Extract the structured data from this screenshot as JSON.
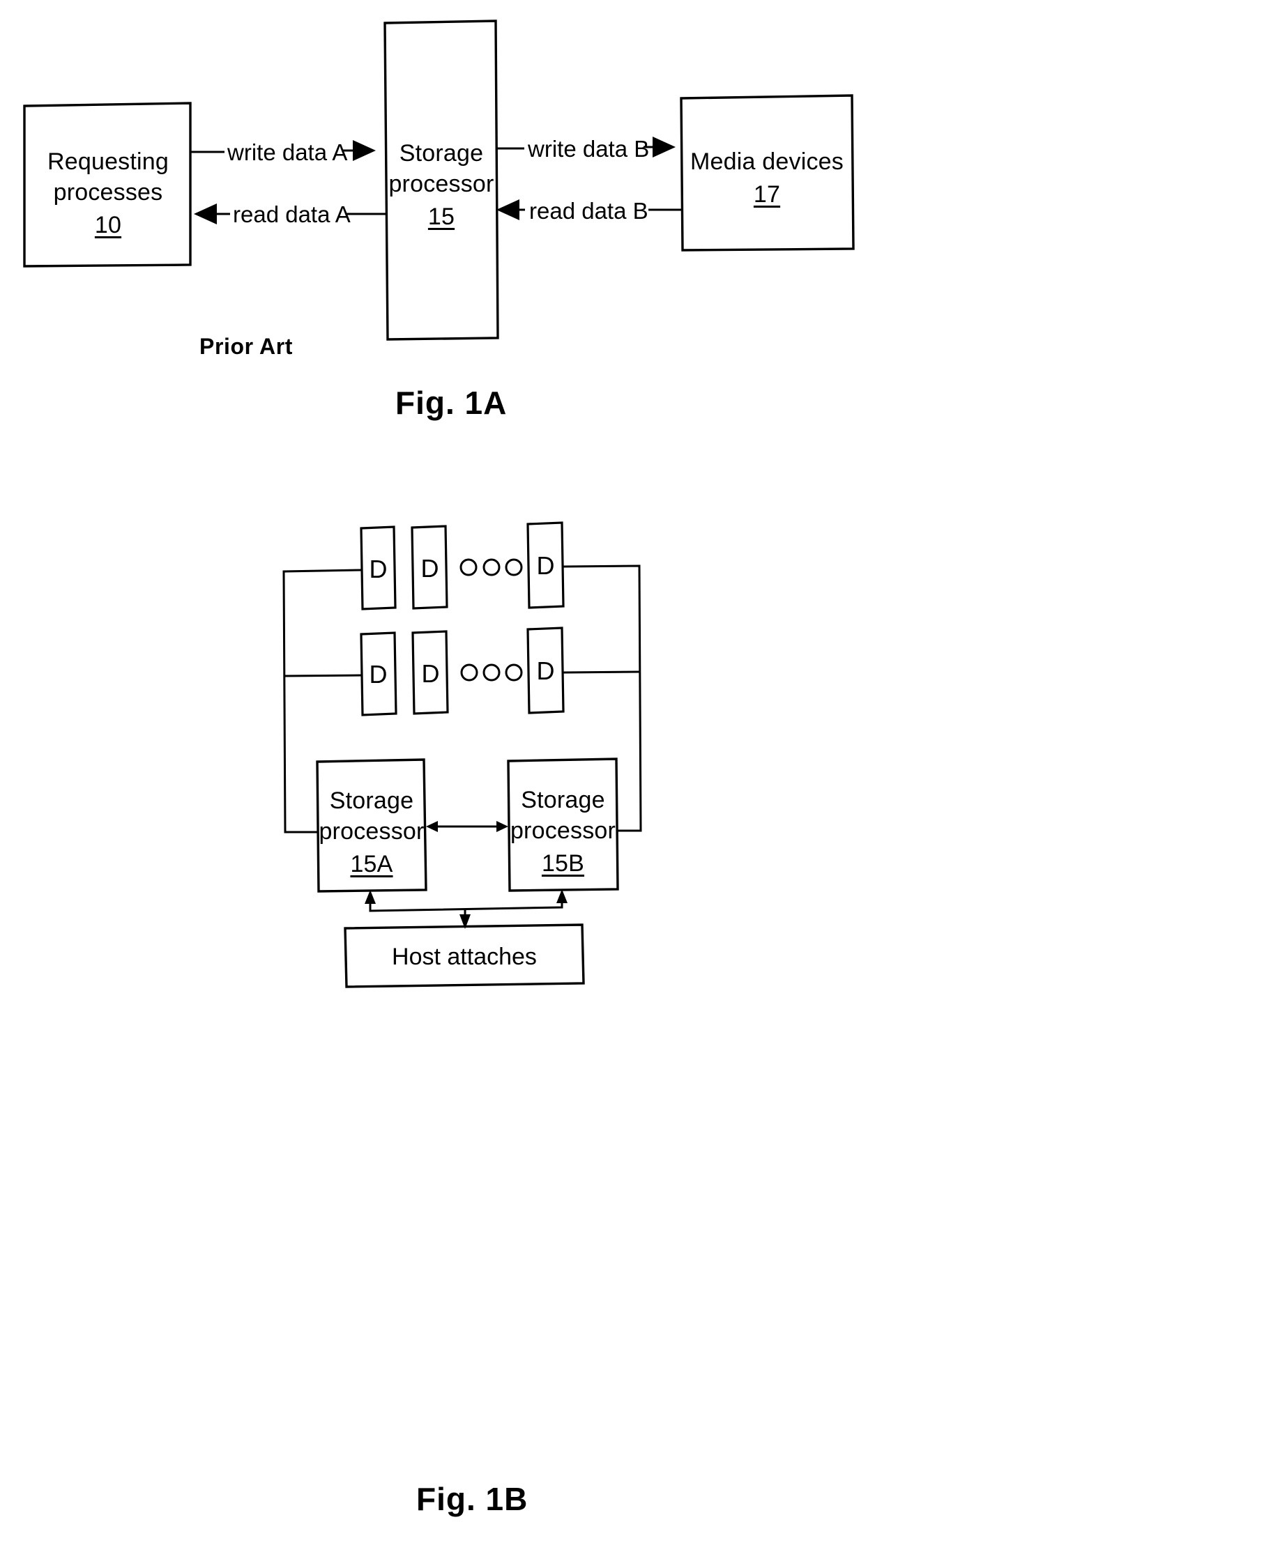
{
  "document": {
    "type": "patent-figure-sheet",
    "figures": [
      "Fig. 1A",
      "Fig. 1B"
    ]
  },
  "fig1a": {
    "caption": "Fig. 1A",
    "prior_art_label": "Prior Art",
    "boxes": [
      {
        "id": "requesting-processes",
        "line1": "Requesting",
        "line2": "processes",
        "ref": "10"
      },
      {
        "id": "storage-processor",
        "line1": "Storage",
        "line2": "processor",
        "ref": "15"
      },
      {
        "id": "media-devices",
        "line1": "Media devices",
        "line2": "",
        "ref": "17"
      }
    ],
    "edges": [
      {
        "id": "write-data-a",
        "label": "write data A",
        "from": "requesting-processes",
        "to": "storage-processor",
        "direction": "right"
      },
      {
        "id": "read-data-a",
        "label": "read data A",
        "from": "storage-processor",
        "to": "requesting-processes",
        "direction": "left"
      },
      {
        "id": "write-data-b",
        "label": "write data B",
        "from": "storage-processor",
        "to": "media-devices",
        "direction": "right"
      },
      {
        "id": "read-data-b",
        "label": "read data B",
        "from": "media-devices",
        "to": "storage-processor",
        "direction": "left"
      }
    ]
  },
  "fig1b": {
    "caption": "Fig. 1B",
    "device_letter": "D",
    "ellipsis_dot_count": 3,
    "rows": [
      {
        "id": "device-row-top",
        "devices": [
          "D",
          "D",
          "D"
        ],
        "ellipsis": "○ ○ ○"
      },
      {
        "id": "device-row-bottom",
        "devices": [
          "D",
          "D",
          "D"
        ],
        "ellipsis": "○ ○ ○"
      }
    ],
    "boxes": [
      {
        "id": "storage-processor-a",
        "line1": "Storage",
        "line2": "processor",
        "ref": "15A"
      },
      {
        "id": "storage-processor-b",
        "line1": "Storage",
        "line2": "processor",
        "ref": "15B"
      },
      {
        "id": "host-attaches",
        "label": "Host attaches"
      }
    ],
    "links": [
      {
        "id": "interconnect-15a-15b",
        "from": "storage-processor-a",
        "to": "storage-processor-b",
        "direction": "bidirectional"
      },
      {
        "id": "host-to-15a",
        "from": "host-attaches",
        "to": "storage-processor-a",
        "direction": "up"
      },
      {
        "id": "host-to-15b",
        "from": "host-attaches",
        "to": "storage-processor-b",
        "direction": "up"
      },
      {
        "id": "bus-to-host",
        "from": "bus",
        "to": "host-attaches",
        "direction": "down"
      }
    ]
  },
  "colors": {
    "ink": "#000000",
    "paper": "#ffffff"
  }
}
